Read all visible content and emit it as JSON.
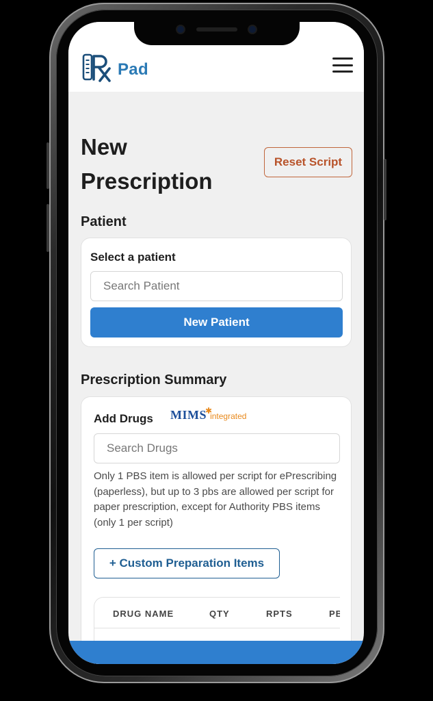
{
  "header": {
    "logo_text": "Pad",
    "menu_icon": "hamburger-menu-icon"
  },
  "page": {
    "title": "New Prescription",
    "reset_label": "Reset Script"
  },
  "patient": {
    "section_label": "Patient",
    "card_heading": "Select a patient",
    "search_placeholder": "Search Patient",
    "new_patient_label": "New Patient"
  },
  "summary": {
    "section_label": "Prescription Summary",
    "add_drugs_heading": "Add Drugs",
    "mims_brand": "MIMS",
    "mims_suffix": "integrated",
    "search_placeholder": "Search Drugs",
    "note": "Only 1 PBS item is allowed per script for ePrescribing (paperless), but up to 3 pbs are allowed per script for paper prescription, except for Authority PBS items (only 1 per script)",
    "custom_button_label": "+ Custom Preparation Items",
    "table": {
      "columns": [
        "DRUG NAME",
        "QTY",
        "RPTS",
        "PB"
      ]
    }
  },
  "colors": {
    "primary": "#2f7fcf",
    "reset_accent": "#b8532a",
    "outline_blue": "#1f5e92",
    "mims_orange": "#e8891c",
    "page_bg": "#f0f0f0"
  }
}
